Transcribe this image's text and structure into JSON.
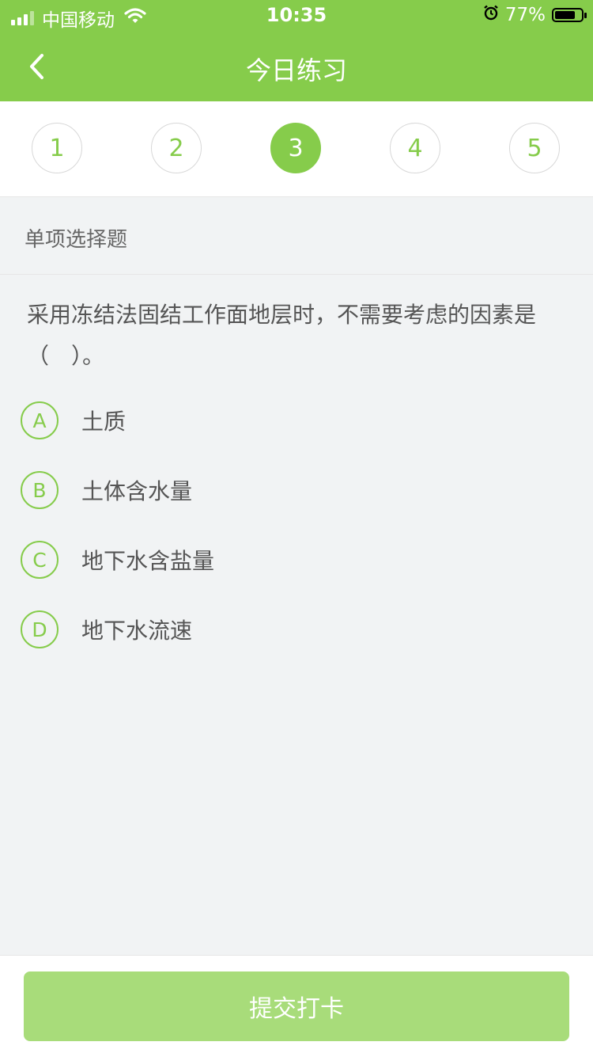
{
  "status_bar": {
    "carrier": "中国移动",
    "time": "10:35",
    "battery": "77%",
    "battery_level": 0.77
  },
  "nav": {
    "title": "今日练习",
    "back_icon": "chevron-left-icon"
  },
  "steps": {
    "items": [
      "1",
      "2",
      "3",
      "4",
      "5"
    ],
    "active_index": 2
  },
  "question": {
    "type_label": "单项选择题",
    "text": "采用冻结法固结工作面地层时，不需要考虑的因素是（　）。",
    "options": [
      {
        "letter": "A",
        "text": "土质"
      },
      {
        "letter": "B",
        "text": "土体含水量"
      },
      {
        "letter": "C",
        "text": "地下水含盐量"
      },
      {
        "letter": "D",
        "text": "地下水流速"
      }
    ]
  },
  "footer": {
    "submit_label": "提交打卡"
  },
  "colors": {
    "accent": "#86cc4b",
    "button_disabled": "#a8dc7a",
    "background": "#f1f3f4"
  }
}
